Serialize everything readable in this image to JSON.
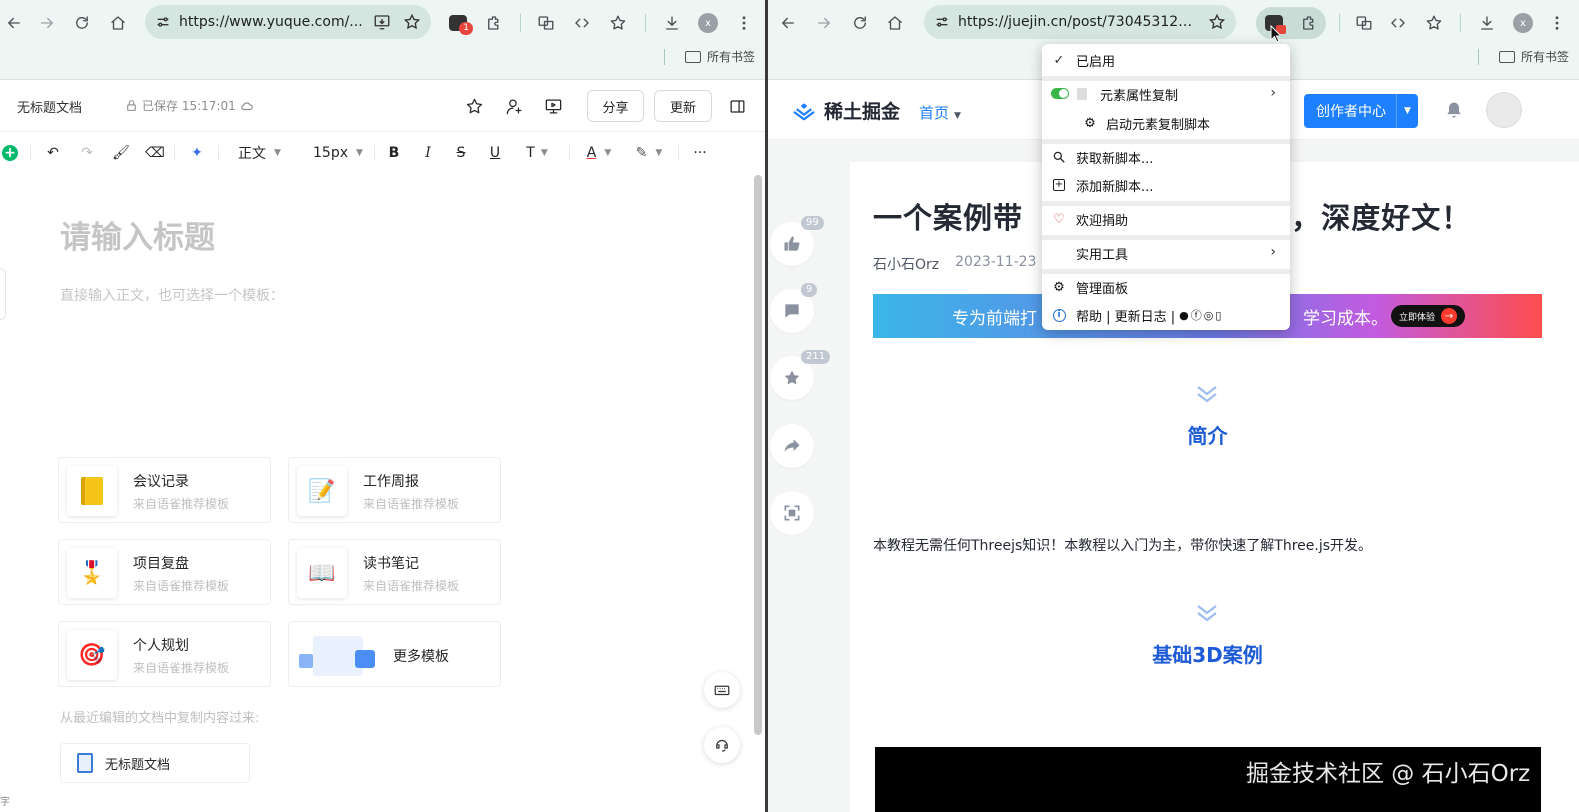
{
  "left_browser": {
    "url": "https://www.yuque.com/...",
    "extension_badge": "1",
    "profile_initial": "x",
    "bookmarks_label": "所有书签"
  },
  "yuque": {
    "doc_title": "无标题文档",
    "saved_status": "已保存 15:17:01",
    "share_button": "分享",
    "update_button": "更新",
    "toolbar": {
      "paragraph_style": "正文",
      "font_size": "15px",
      "more": "···"
    },
    "title_placeholder": "请输入标题",
    "body_hint": "直接输入正文，也可选择一个模板：",
    "templates": [
      {
        "title": "会议记录",
        "subtitle": "来自语雀推荐模板",
        "icon": "notebook-icon"
      },
      {
        "title": "工作周报",
        "subtitle": "来自语雀推荐模板",
        "icon": "memo-icon"
      },
      {
        "title": "项目复盘",
        "subtitle": "来自语雀推荐模板",
        "icon": "medal-icon"
      },
      {
        "title": "读书笔记",
        "subtitle": "来自语雀推荐模板",
        "icon": "book-icon"
      },
      {
        "title": "个人规划",
        "subtitle": "来自语雀推荐模板",
        "icon": "target-icon"
      },
      {
        "title": "更多模板",
        "subtitle": "",
        "icon": "template-preview-icon"
      }
    ],
    "copy_hint": "从最近编辑的文档中复制内容过来:",
    "recent_doc": "无标题文档",
    "word_count_label": "字"
  },
  "right_browser": {
    "url": "https://juejin.cn/post/73045312037...",
    "profile_initial": "x",
    "bookmarks_label": "所有书签"
  },
  "juejin": {
    "logo_text": "稀土掘金",
    "nav_home": "首页",
    "creator_center": "创作者中心",
    "title_left": "一个案例带",
    "title_right": "s，深度好文！",
    "author": "石小石Orz",
    "date": "2023-11-23",
    "banner_left": "专为前端打",
    "banner_right": "学习成本。",
    "banner_button": "立即体验",
    "side_counts": {
      "like": "99",
      "comment": "9",
      "collect": "211"
    },
    "section_intro": "简介",
    "intro_text": "本教程无需任何Threejs知识！本教程以入门为主，带你快速了解Three.js开发。",
    "section_basic": "基础3D案例",
    "watermark": "掘金技术社区 @ 石小石Orz"
  },
  "menu": {
    "enabled": "已启用",
    "element_copy": "元素属性复制",
    "start_script": "启动元素复制脚本",
    "get_script": "获取新脚本...",
    "add_script": "添加新脚本...",
    "donate": "欢迎捐助",
    "tools": "实用工具",
    "dashboard": "管理面板",
    "help": "帮助 | 更新日志 |",
    "colors": {
      "toggle_on": "#39b54a",
      "heart": "#d6453d"
    }
  }
}
